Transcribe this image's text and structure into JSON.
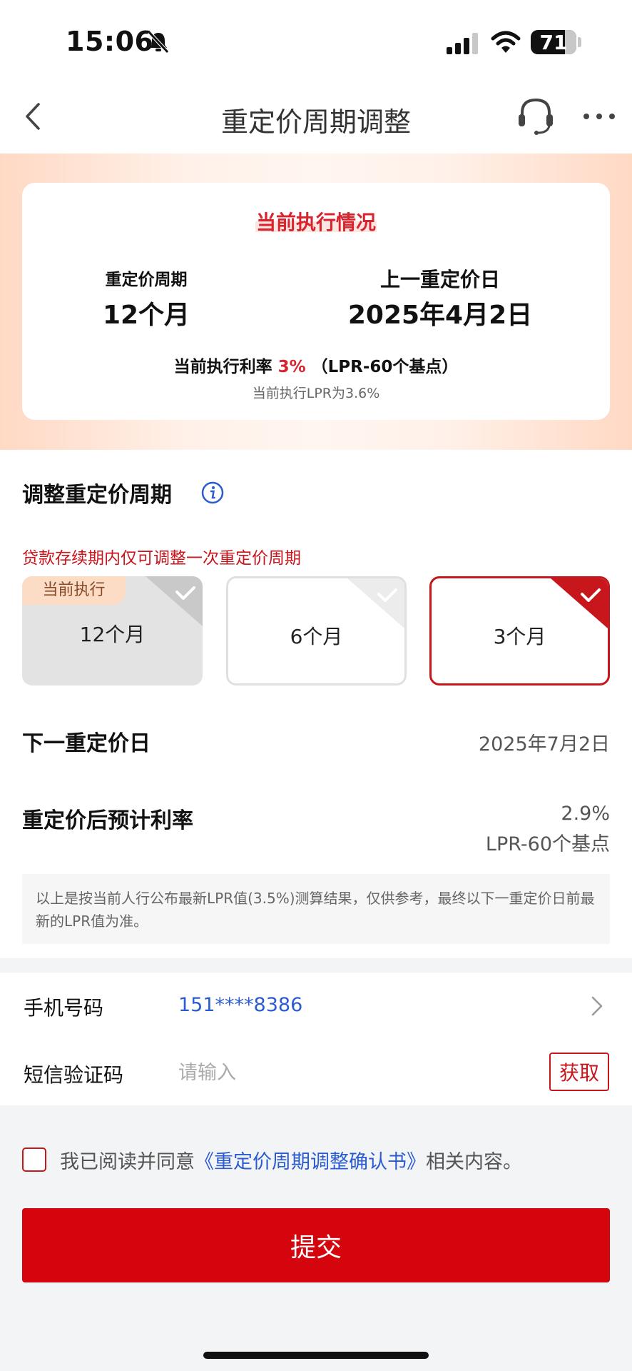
{
  "status_bar": {
    "time": "15:06",
    "battery": "71"
  },
  "nav": {
    "title": "重定价周期调整"
  },
  "summary": {
    "title": "当前执行情况",
    "cycle_label": "重定价周期",
    "cycle_value": "12个月",
    "last_date_label": "上一重定价日",
    "last_date_value": "2025年4月2日",
    "rate_prefix": "当前执行利率",
    "rate_value": "3%",
    "rate_suffix": "（LPR-60个基点）",
    "lpr_note": "当前执行LPR为3.6%"
  },
  "adjust": {
    "title": "调整重定价周期",
    "warning": "贷款存续期内仅可调整一次重定价周期",
    "options": [
      {
        "label": "12个月",
        "badge": "当前执行"
      },
      {
        "label": "6个月"
      },
      {
        "label": "3个月"
      }
    ],
    "selected_index": 2,
    "next_date_label": "下一重定价日",
    "next_date_value": "2025年7月2日",
    "est_rate_label": "重定价后预计利率",
    "est_rate_value": "2.9%",
    "est_rate_lpr": "LPR-60个基点",
    "disclaimer": "以上是按当前人行公布最新LPR值(3.5%)测算结果，仅供参考，最终以下一重定价日前最新的LPR值为准。"
  },
  "form": {
    "phone_label": "手机号码",
    "phone_value": "151****8386",
    "sms_label": "短信验证码",
    "sms_placeholder": "请输入",
    "get_code_label": "获取"
  },
  "agreement": {
    "prefix": "我已阅读并同意",
    "link": "《重定价周期调整确认书》",
    "suffix": "相关内容。"
  },
  "submit_label": "提交",
  "colors": {
    "brand_red": "#d4050d",
    "link_blue": "#2b5bd1",
    "warning_red": "#c8161d"
  },
  "icons": [
    "bell-slash-icon",
    "signal-icon",
    "wifi-icon",
    "back-icon",
    "headset-icon",
    "more-icon",
    "info-icon",
    "check-icon",
    "chevron-right-icon"
  ]
}
